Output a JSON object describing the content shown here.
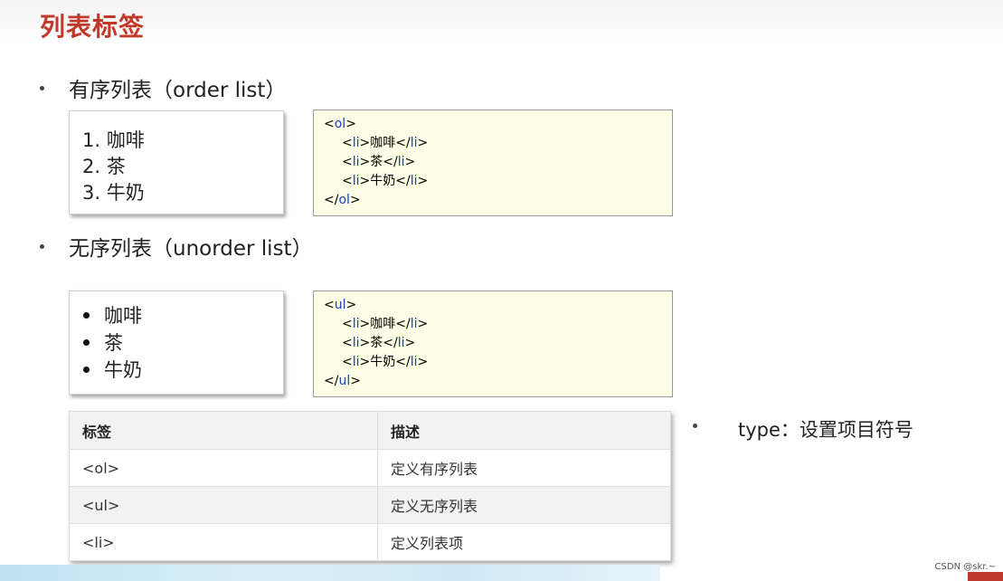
{
  "title": "列表标签",
  "sections": {
    "ordered": {
      "heading": "有序列表（order list）",
      "items": [
        "1. 咖啡",
        "2. 茶",
        "3. 牛奶"
      ],
      "code": {
        "open_tag": "ol",
        "items": [
          "咖啡",
          "茶",
          "牛奶"
        ]
      }
    },
    "unordered": {
      "heading": "无序列表（unorder list）",
      "items": [
        "咖啡",
        "茶",
        "牛奶"
      ],
      "code": {
        "open_tag": "ul",
        "items": [
          "咖啡",
          "茶",
          "牛奶"
        ]
      }
    }
  },
  "table": {
    "headers": [
      "标签",
      "描述"
    ],
    "rows": [
      [
        "<ol>",
        "定义有序列表"
      ],
      [
        "<ul>",
        "定义无序列表"
      ],
      [
        "<li>",
        "定义列表项"
      ]
    ]
  },
  "type_note": "type：设置项目符号",
  "watermark": "CSDN @skr.~",
  "colors": {
    "title": "#c0392b",
    "code_background": "#fefee6",
    "code_tag": "#1a3fb5"
  }
}
